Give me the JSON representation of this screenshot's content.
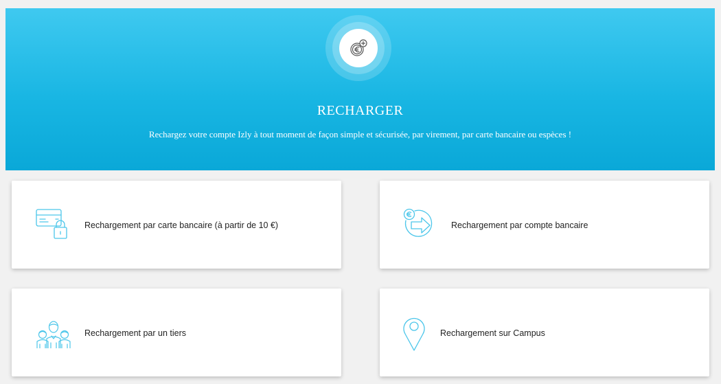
{
  "hero": {
    "title": "RECHARGER",
    "subtitle": "Rechargez votre compte Izly à tout moment de façon simple et sécurisée, par virement, par carte bancaire ou espèces !",
    "icon": "euro-coin-plus-icon",
    "gradient": [
      "#3fc9f0",
      "#0aa8d8"
    ]
  },
  "options": [
    {
      "label": "Rechargement par carte bancaire (à partir de 10 €)",
      "icon": "credit-card-lock-icon"
    },
    {
      "label": "Rechargement par compte bancaire",
      "icon": "euro-transfer-arrow-icon"
    },
    {
      "label": "Rechargement par un tiers",
      "icon": "group-people-icon"
    },
    {
      "label": "Rechargement sur Campus",
      "icon": "map-pin-icon"
    }
  ],
  "colors": {
    "accent": "#2bbbe6",
    "icon_stroke": "#4cc6ea",
    "page_bg": "#f1f1f1",
    "card_bg": "#ffffff"
  }
}
